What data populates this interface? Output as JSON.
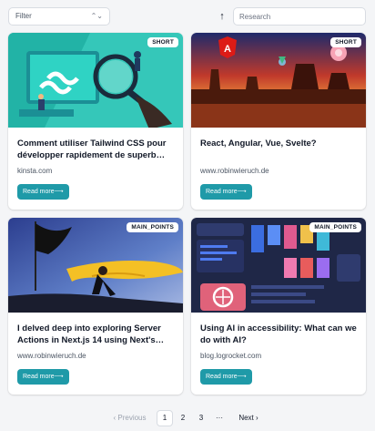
{
  "toolbar": {
    "filter_value": "Filter",
    "filter_chevron": "⌃",
    "sort_icon": "↑",
    "search_placeholder": "Research"
  },
  "cards": [
    {
      "badge": "SHORT",
      "title": "Comment utiliser Tailwind CSS pour développer rapidement de superb…",
      "source": "kinsta.com",
      "button": "Read more⟶"
    },
    {
      "badge": "SHORT",
      "title": "React, Angular, Vue, Svelte?",
      "source": "www.robinwieruch.de",
      "button": "Read more⟶"
    },
    {
      "badge": "MAIN_POINTS",
      "title": "I delved deep into exploring Server Actions in Next.js 14 using Next's…",
      "source": "www.robinwieruch.de",
      "button": "Read more⟶"
    },
    {
      "badge": "MAIN_POINTS",
      "title": "Using AI in accessibility: What can we do with AI?",
      "source": "blog.logrocket.com",
      "button": "Read more⟶"
    }
  ],
  "pagination": {
    "previous": "‹  Previous",
    "pages": [
      "1",
      "2",
      "3"
    ],
    "ellipsis": "···",
    "next": "Next  ›",
    "current": "1"
  }
}
